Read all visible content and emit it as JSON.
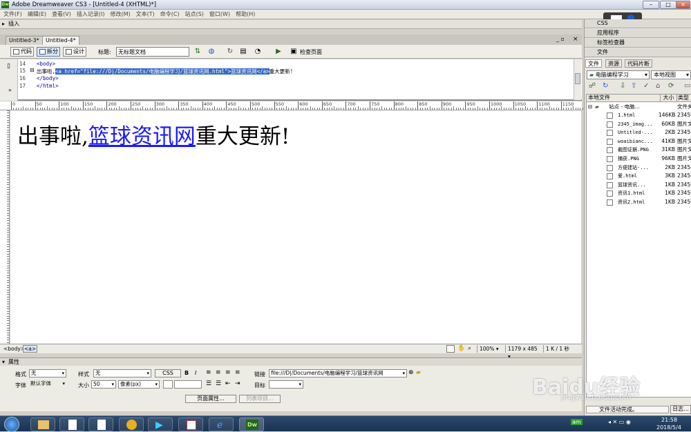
{
  "window": {
    "title": "Adobe Dreamweaver CS3 - [Untitled-4 (XHTML)*]"
  },
  "menu": [
    "文件(F)",
    "编辑(E)",
    "查看(V)",
    "插入记录(I)",
    "修改(M)",
    "文本(T)",
    "命令(C)",
    "站点(S)",
    "窗口(W)",
    "帮助(H)"
  ],
  "insert_bar": {
    "label": "插入"
  },
  "tabs": [
    "Untitled-3*",
    "Untitled-4*"
  ],
  "toolbar": {
    "code_label": "代码",
    "split_label": "拆分",
    "design_label": "设计",
    "title_label": "标题:",
    "title_value": "无标题文档",
    "check_page_label": "检查页面"
  },
  "code": {
    "lines": [
      {
        "num": "14",
        "pre": "<body>",
        "sel": "",
        "post": ""
      },
      {
        "num": "15",
        "pre": "出事啦,",
        "sel": "<a href=\"file:///D|/Documents/电脑编程学习/篮球资讯网.html\">篮球资讯网</a>",
        "post": "重大更新!"
      },
      {
        "num": "16",
        "pre": "</body>",
        "sel": "",
        "post": ""
      },
      {
        "num": "17",
        "pre": "</html>",
        "sel": "",
        "post": ""
      }
    ]
  },
  "ruler": {
    "ticks": [
      "0",
      "50",
      "100",
      "150",
      "200",
      "250",
      "300",
      "350",
      "400",
      "450",
      "500",
      "550",
      "600",
      "650",
      "700",
      "750",
      "800",
      "850",
      "900",
      "950",
      "1000",
      "1050",
      "1100",
      "1150"
    ]
  },
  "design_view": {
    "before": "出事啦,",
    "link": "篮球资讯网",
    "after": "重大更新!"
  },
  "status_bar": {
    "tag": "<body>",
    "tag2": "<a>",
    "zoom": "100%",
    "size": "1179 x 485",
    "download": "1 K / 1 秒"
  },
  "properties": {
    "title": "属性",
    "format_label": "格式",
    "format_value": "无",
    "style_label": "样式",
    "style_value": "无",
    "css_button": "CSS",
    "bold": "B",
    "italic": "I",
    "link_label": "链接",
    "link_value": "file:///D|/Documents/电脑编程学习/篮球资讯网",
    "font_label": "字体",
    "font_value": "默认字体",
    "size_label": "大小",
    "size_value": "50",
    "size_unit": "像素(px)",
    "target_label": "目标",
    "page_props_button": "页面属性...",
    "list_item_button": "列表项目..."
  },
  "right_panel": {
    "css": "CSS",
    "app": "应用程序",
    "tag_inspector": "标签检查器",
    "files": "文件",
    "file_tabs": [
      "文件",
      "资源",
      "代码片断"
    ],
    "site_select": "电脑编程学习",
    "view_select": "本地视图",
    "cols": {
      "name": "本地文件",
      "size": "大小",
      "type": "类型"
    },
    "root": "站点 - 电脑...",
    "root_type": "文件夹",
    "files_list": [
      {
        "name": "1.html",
        "size": "146KB",
        "type": "2345E"
      },
      {
        "name": "2345_imag...",
        "size": "60KB",
        "type": "图片文"
      },
      {
        "name": "Untitled-...",
        "size": "2KB",
        "type": "2345E"
      },
      {
        "name": "woaibianc...",
        "size": "41KB",
        "type": "图片文"
      },
      {
        "name": "截图证据.PNG",
        "size": "31KB",
        "type": "图片文"
      },
      {
        "name": "捕获.PNG",
        "size": "96KB",
        "type": "图片文"
      },
      {
        "name": "方便建站-...",
        "size": "2KB",
        "type": "2345E"
      },
      {
        "name": "爱.html",
        "size": "3KB",
        "type": "2345E"
      },
      {
        "name": "篮球资讯...",
        "size": "1KB",
        "type": "2345E"
      },
      {
        "name": "资讯1.html",
        "size": "1KB",
        "type": "2345E"
      },
      {
        "name": "资讯2.html",
        "size": "1KB",
        "type": "2345E"
      }
    ],
    "bottom_status": "文件活动完成。",
    "log_button": "日志..."
  },
  "taskbar": {
    "time": "21:58",
    "date": "2018/5/4"
  },
  "watermark": {
    "main": "Baidu经验",
    "sub": "jingyan.baidu.com"
  }
}
